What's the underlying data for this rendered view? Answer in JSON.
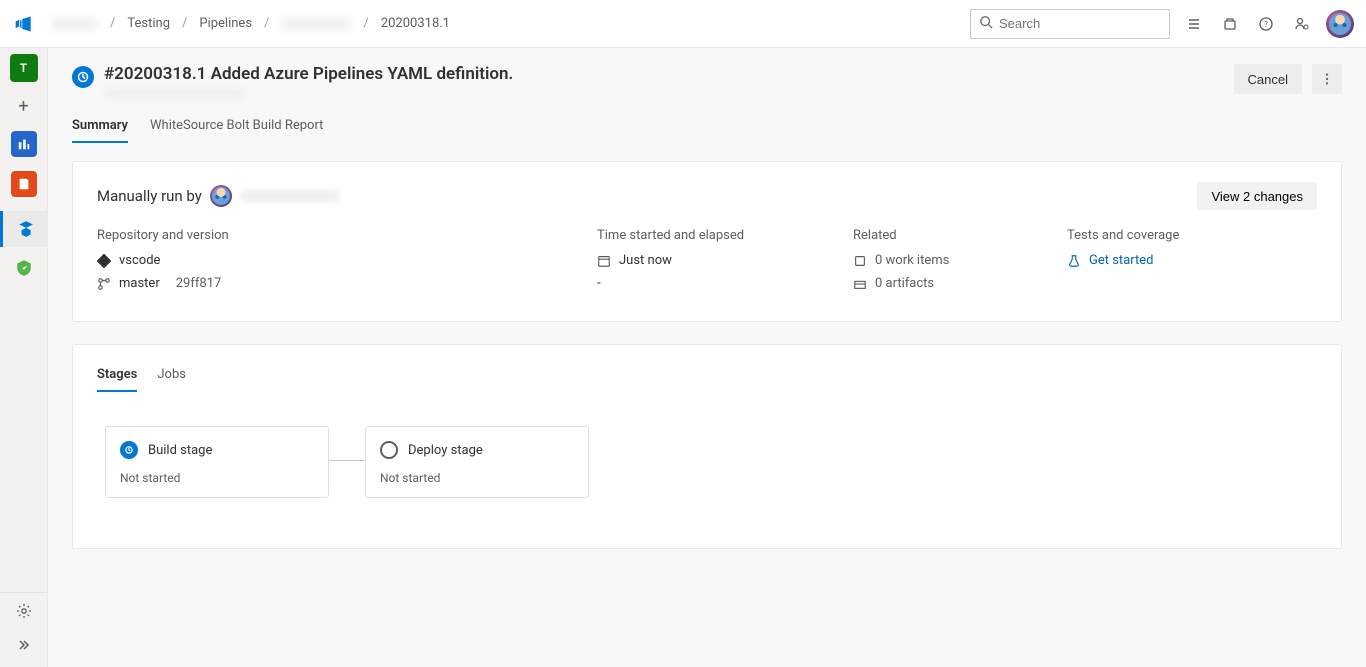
{
  "breadcrumb": {
    "items": [
      "Testing",
      "Pipelines",
      "20200318.1"
    ]
  },
  "search": {
    "placeholder": "Search"
  },
  "page": {
    "title": "#20200318.1 Added Azure Pipelines YAML definition.",
    "cancel": "Cancel"
  },
  "tabs": {
    "summary": "Summary",
    "whitesource": "WhiteSource Bolt Build Report"
  },
  "run": {
    "prefix": "Manually run by",
    "viewChanges": "View 2 changes"
  },
  "repo": {
    "label": "Repository and version",
    "name": "vscode",
    "branch": "master",
    "commit": "29ff817"
  },
  "time": {
    "label": "Time started and elapsed",
    "started": "Just now",
    "elapsed": "-"
  },
  "related": {
    "label": "Related",
    "workItems": "0 work items",
    "artifacts": "0 artifacts"
  },
  "tests": {
    "label": "Tests and coverage",
    "getStarted": "Get started"
  },
  "stageTabs": {
    "stages": "Stages",
    "jobs": "Jobs"
  },
  "stages": [
    {
      "name": "Build stage",
      "status": "Not started",
      "icon": "waiting"
    },
    {
      "name": "Deploy stage",
      "status": "Not started",
      "icon": "idle"
    }
  ],
  "sidebar": {
    "project_initial": "T"
  }
}
